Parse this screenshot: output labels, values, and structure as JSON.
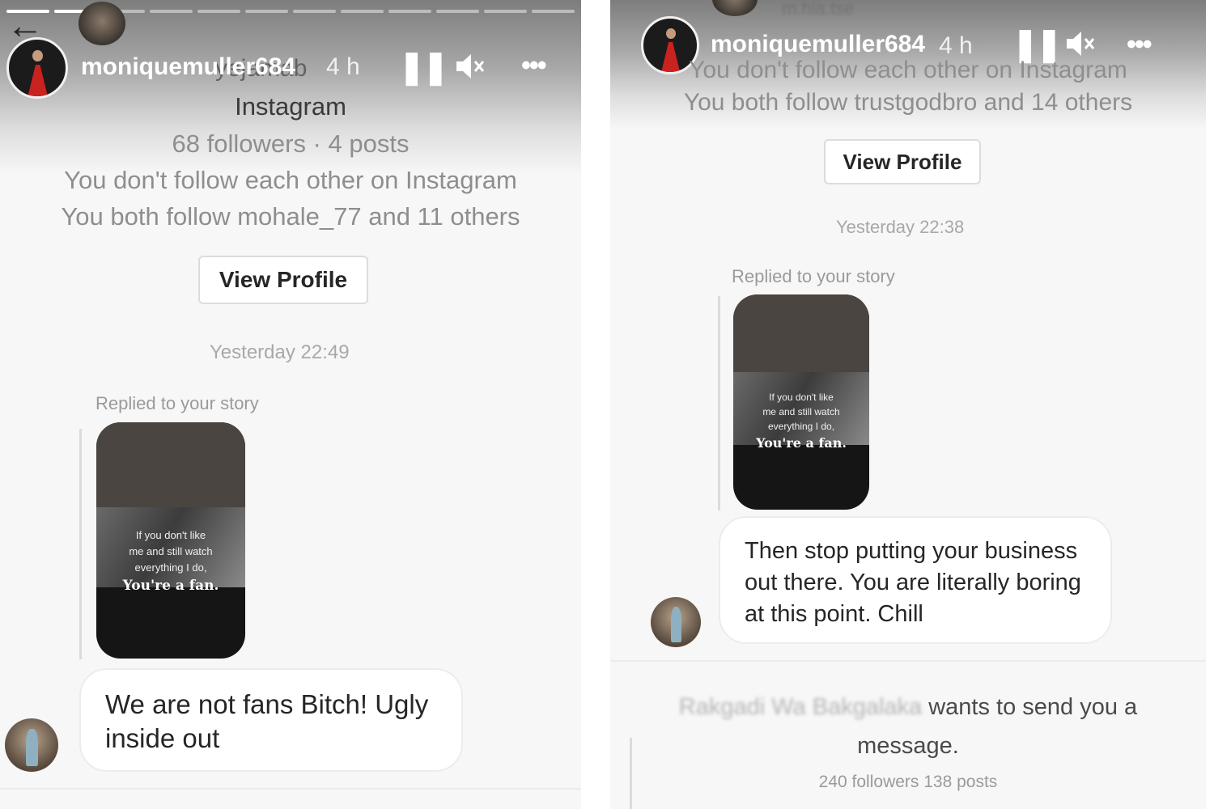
{
  "left": {
    "username": "moniquemuller684",
    "age": "4 h",
    "ghost_name": "yejamab",
    "title": "Instagram",
    "stats": "68 followers · 4 posts",
    "follow_note": "You don't follow each other on Instagram",
    "mutual": "You both follow mohale_77 and 11 others",
    "view_profile": "View Profile",
    "timestamp": "Yesterday 22:49",
    "replied": "Replied to your story",
    "story_lines": [
      "If you don't like",
      "me and still watch",
      "everything I do,"
    ],
    "story_fan": "You're a fan.",
    "message": "We are not fans Bitch! Ugly inside out"
  },
  "right": {
    "username": "moniquemuller684",
    "age": "4 h",
    "ghost_top": "m.hia.tse",
    "follow_note": "You don't follow each other on Instagram",
    "mutual": "You both follow trustgodbro and 14 others",
    "view_profile": "View Profile",
    "timestamp": "Yesterday 22:38",
    "replied": "Replied to your story",
    "story_lines": [
      "If you don't like",
      "me and still watch",
      "everything I do,"
    ],
    "story_fan": "You're a fan.",
    "message": "Then stop putting your business out there. You are literally boring at this point. Chill",
    "request_name": "Rakgadi Wa Bakgalaka",
    "request_text": "wants to send you a message.",
    "request_stats": "240 followers 138 posts"
  },
  "controls": {
    "pause": "❚❚",
    "mute": "🔇",
    "more": "•••",
    "back": "←"
  }
}
